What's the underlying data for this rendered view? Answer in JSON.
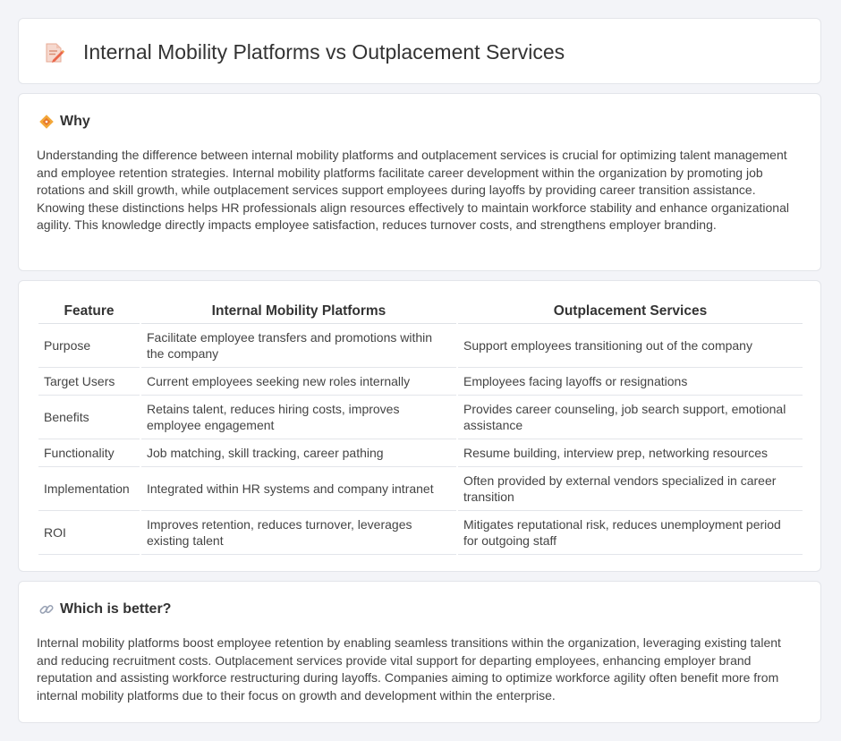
{
  "header": {
    "title": "Internal Mobility Platforms vs Outplacement Services",
    "icon": "document-pencil-icon"
  },
  "why": {
    "heading": "Why",
    "icon": "diamond-icon",
    "text": "Understanding the difference between internal mobility platforms and outplacement services is crucial for optimizing talent management and employee retention strategies. Internal mobility platforms facilitate career development within the organization by promoting job rotations and skill growth, while outplacement services support employees during layoffs by providing career transition assistance. Knowing these distinctions helps HR professionals align resources effectively to maintain workforce stability and enhance organizational agility. This knowledge directly impacts employee satisfaction, reduces turnover costs, and strengthens employer branding."
  },
  "table": {
    "headers": [
      "Feature",
      "Internal Mobility Platforms",
      "Outplacement Services"
    ],
    "rows": [
      [
        "Purpose",
        "Facilitate employee transfers and promotions within the company",
        "Support employees transitioning out of the company"
      ],
      [
        "Target Users",
        "Current employees seeking new roles internally",
        "Employees facing layoffs or resignations"
      ],
      [
        "Benefits",
        "Retains talent, reduces hiring costs, improves employee engagement",
        "Provides career counseling, job search support, emotional assistance"
      ],
      [
        "Functionality",
        "Job matching, skill tracking, career pathing",
        "Resume building, interview prep, networking resources"
      ],
      [
        "Implementation",
        "Integrated within HR systems and company intranet",
        "Often provided by external vendors specialized in career transition"
      ],
      [
        "ROI",
        "Improves retention, reduces turnover, leverages existing talent",
        "Mitigates reputational risk, reduces unemployment period for outgoing staff"
      ]
    ]
  },
  "better": {
    "heading": "Which is better?",
    "icon": "link-icon",
    "text": "Internal mobility platforms boost employee retention by enabling seamless transitions within the organization, leveraging existing talent and reducing recruitment costs. Outplacement services provide vital support for departing employees, enhancing employer brand reputation and assisting workforce restructuring during layoffs. Companies aiming to optimize workforce agility often benefit more from internal mobility platforms due to their focus on growth and development within the enterprise."
  }
}
